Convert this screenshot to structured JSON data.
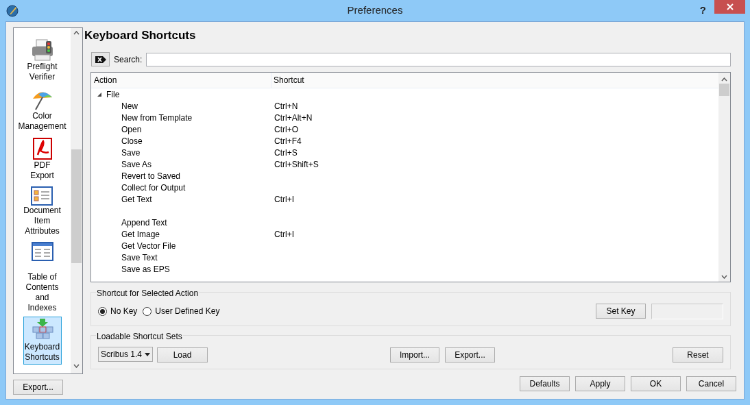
{
  "window": {
    "title": "Preferences",
    "help": "?"
  },
  "sidebar": {
    "items": [
      {
        "label": "Preflight\nVerifier",
        "kind": "printer",
        "selected": false
      },
      {
        "label": "Color\nManagement",
        "kind": "umbrella",
        "selected": false
      },
      {
        "label": "PDF\nExport",
        "kind": "pdf",
        "selected": false
      },
      {
        "label": "Document\nItem\nAttributes",
        "kind": "attributes",
        "selected": false
      },
      {
        "label": "Table of\nContents\nand\nIndexes",
        "kind": "toc",
        "selected": false
      },
      {
        "label": "Keyboard\nShortcuts",
        "kind": "keyboard",
        "selected": true
      }
    ],
    "export_button": "Export..."
  },
  "page_title": "Keyboard Shortcuts",
  "search": {
    "label": "Search:"
  },
  "table": {
    "columns": [
      "Action",
      "Shortcut"
    ],
    "tree": [
      {
        "label": "File",
        "expanded": true,
        "children": [
          {
            "kind": "action",
            "action": "New",
            "shortcut": "Ctrl+N"
          },
          {
            "kind": "action",
            "action": "New from Template",
            "shortcut": "Ctrl+Alt+N"
          },
          {
            "kind": "action",
            "action": "Open",
            "shortcut": "Ctrl+O"
          },
          {
            "kind": "action",
            "action": "Close",
            "shortcut": "Ctrl+F4"
          },
          {
            "kind": "action",
            "action": "Save",
            "shortcut": "Ctrl+S"
          },
          {
            "kind": "action",
            "action": "Save As",
            "shortcut": "Ctrl+Shift+S"
          },
          {
            "kind": "action",
            "action": "Revert to Saved"
          },
          {
            "kind": "action",
            "action": "Collect for Output"
          },
          {
            "kind": "action",
            "action": "Get Text",
            "shortcut": "Ctrl+I"
          },
          {
            "kind": "separator"
          },
          {
            "kind": "action",
            "action": "Append Text"
          },
          {
            "kind": "action",
            "action": "Get Image",
            "shortcut": "Ctrl+I"
          },
          {
            "kind": "action",
            "action": "Get Vector File"
          },
          {
            "kind": "action",
            "action": "Save Text"
          },
          {
            "kind": "action",
            "action": "Save as EPS"
          }
        ]
      }
    ]
  },
  "shortcut_group": {
    "title": "Shortcut for Selected Action",
    "radios": [
      {
        "label": "No Key",
        "selected": true
      },
      {
        "label": "User Defined Key",
        "selected": false
      }
    ],
    "set_key_button": "Set Key"
  },
  "sets_group": {
    "title": "Loadable Shortcut Sets",
    "combo": "Scribus 1.4",
    "load_button": "Load",
    "import_button": "Import...",
    "export_button": "Export...",
    "reset_button": "Reset"
  },
  "buttons": [
    "Defaults",
    "Apply",
    "OK",
    "Cancel"
  ]
}
